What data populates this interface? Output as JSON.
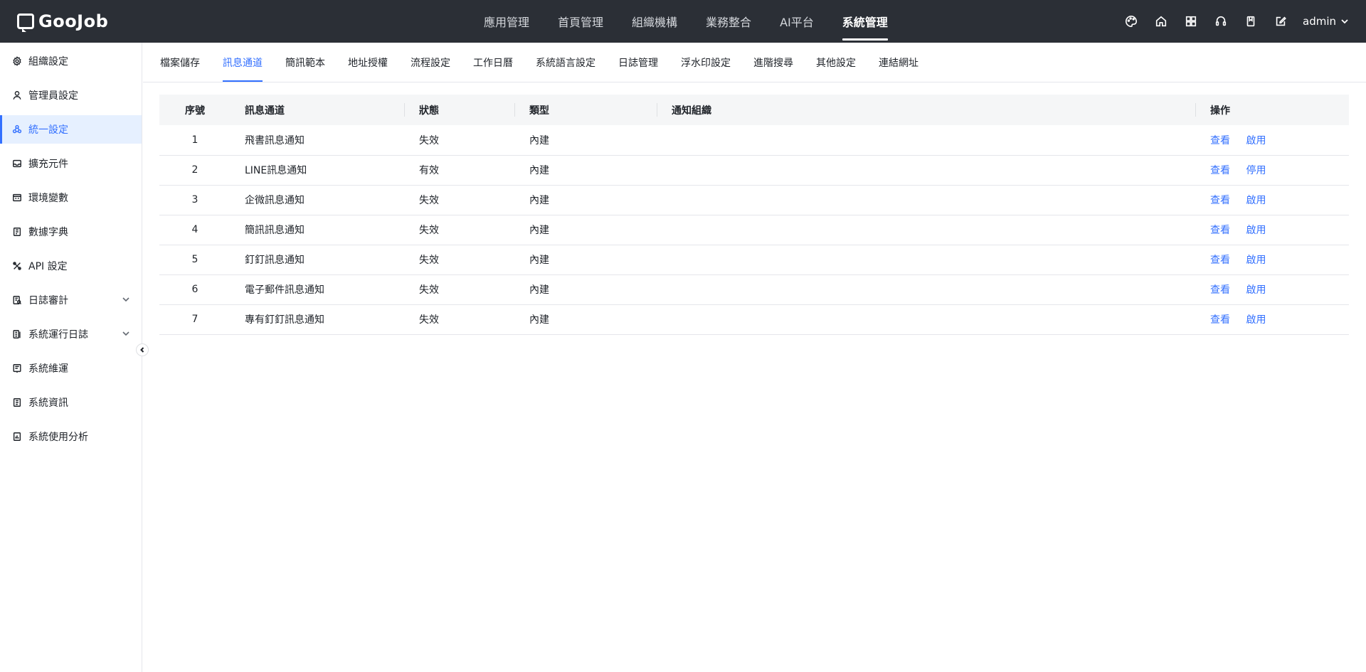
{
  "app": {
    "logo_text": "GooJob"
  },
  "topnav": {
    "items": [
      {
        "label": "應用管理",
        "active": false
      },
      {
        "label": "首頁管理",
        "active": false
      },
      {
        "label": "組織機構",
        "active": false
      },
      {
        "label": "業務整合",
        "active": false
      },
      {
        "label": "AI平台",
        "active": false
      },
      {
        "label": "系統管理",
        "active": true
      }
    ],
    "icons": [
      "palette-icon",
      "home-icon",
      "grid-icon",
      "headset-icon",
      "book-icon",
      "edit-icon"
    ],
    "user": "admin"
  },
  "sidebar": {
    "items": [
      {
        "label": "組織設定",
        "icon": "gear-icon"
      },
      {
        "label": "管理員設定",
        "icon": "user-icon"
      },
      {
        "label": "統一設定",
        "icon": "unified-icon",
        "active": true
      },
      {
        "label": "擴充元件",
        "icon": "inbox-icon"
      },
      {
        "label": "環境變數",
        "icon": "terminal-icon"
      },
      {
        "label": "數據字典",
        "icon": "dictionary-icon"
      },
      {
        "label": "API 設定",
        "icon": "api-icon"
      },
      {
        "label": "日誌審計",
        "icon": "audit-icon",
        "expandable": true
      },
      {
        "label": "系統運行日誌",
        "icon": "log-icon",
        "expandable": true
      },
      {
        "label": "系統維運",
        "icon": "maintenance-icon"
      },
      {
        "label": "系統資訊",
        "icon": "info-doc-icon"
      },
      {
        "label": "系統使用分析",
        "icon": "analysis-icon"
      }
    ]
  },
  "subtabs": {
    "items": [
      {
        "label": "檔案儲存"
      },
      {
        "label": "訊息通道",
        "active": true
      },
      {
        "label": "簡訊範本"
      },
      {
        "label": "地址授權"
      },
      {
        "label": "流程設定"
      },
      {
        "label": "工作日曆"
      },
      {
        "label": "系統語言設定"
      },
      {
        "label": "日誌管理"
      },
      {
        "label": "浮水印設定"
      },
      {
        "label": "進階搜尋"
      },
      {
        "label": "其他設定"
      },
      {
        "label": "連結網址"
      }
    ]
  },
  "table": {
    "headers": {
      "index": "序號",
      "channel": "訊息通道",
      "status": "狀態",
      "type": "類型",
      "org": "通知組織",
      "actions": "操作"
    },
    "rows": [
      {
        "index": "1",
        "channel": "飛書訊息通知",
        "status": "失效",
        "type": "內建",
        "org": "",
        "view": "查看",
        "toggle": "啟用"
      },
      {
        "index": "2",
        "channel": "LINE訊息通知",
        "status": "有效",
        "type": "內建",
        "org": "",
        "view": "查看",
        "toggle": "停用"
      },
      {
        "index": "3",
        "channel": "企微訊息通知",
        "status": "失效",
        "type": "內建",
        "org": "",
        "view": "查看",
        "toggle": "啟用"
      },
      {
        "index": "4",
        "channel": "簡訊訊息通知",
        "status": "失效",
        "type": "內建",
        "org": "",
        "view": "查看",
        "toggle": "啟用"
      },
      {
        "index": "5",
        "channel": "釘釘訊息通知",
        "status": "失效",
        "type": "內建",
        "org": "",
        "view": "查看",
        "toggle": "啟用"
      },
      {
        "index": "6",
        "channel": "電子郵件訊息通知",
        "status": "失效",
        "type": "內建",
        "org": "",
        "view": "查看",
        "toggle": "啟用"
      },
      {
        "index": "7",
        "channel": "專有釘釘訊息通知",
        "status": "失效",
        "type": "內建",
        "org": "",
        "view": "查看",
        "toggle": "啟用"
      }
    ]
  },
  "colors": {
    "accent": "#3370ff",
    "topbar": "#2b2f36"
  }
}
